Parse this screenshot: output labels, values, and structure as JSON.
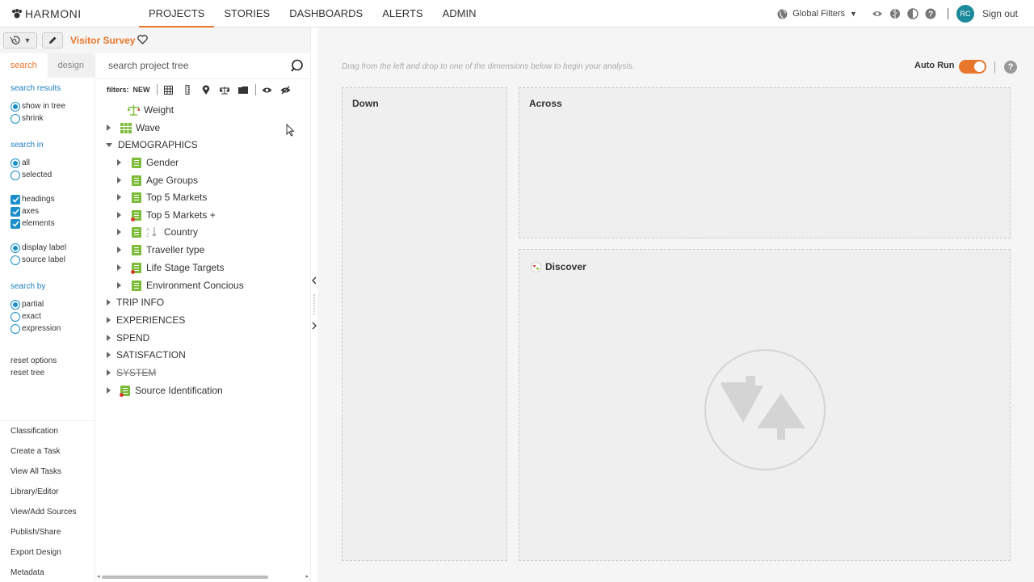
{
  "brand": {
    "name": "HARMONI"
  },
  "nav": {
    "items": [
      {
        "label": "PROJECTS",
        "active": true
      },
      {
        "label": "STORIES"
      },
      {
        "label": "DASHBOARDS"
      },
      {
        "label": "ALERTS"
      },
      {
        "label": "ADMIN"
      }
    ]
  },
  "topright": {
    "global_filters": "Global Filters",
    "icons": [
      "eye-icon",
      "brain-icon",
      "contrast-icon",
      "help-icon"
    ],
    "user_initials": "RC",
    "sign_out": "Sign out"
  },
  "project": {
    "title": "Visitor Survey"
  },
  "left_panel": {
    "tabs": {
      "search": "search",
      "design": "design"
    },
    "search_results": {
      "heading": "search results",
      "options": [
        {
          "label": "show in tree",
          "selected": true
        },
        {
          "label": "shrink",
          "selected": false
        }
      ]
    },
    "search_in": {
      "heading": "search in",
      "scope": [
        {
          "label": "all",
          "selected": true
        },
        {
          "label": "selected",
          "selected": false
        }
      ],
      "types": [
        {
          "label": "headings",
          "checked": true
        },
        {
          "label": "axes",
          "checked": true
        },
        {
          "label": "elements",
          "checked": true
        }
      ],
      "labels": [
        {
          "label": "display label",
          "selected": true
        },
        {
          "label": "source label",
          "selected": false
        }
      ]
    },
    "search_by": {
      "heading": "search by",
      "options": [
        {
          "label": "partial",
          "selected": true
        },
        {
          "label": "exact",
          "selected": false
        },
        {
          "label": "expression",
          "selected": false
        }
      ]
    },
    "links": {
      "reset_options": "reset options",
      "reset_tree": "reset tree"
    },
    "menu": [
      "Classification",
      "Create a Task",
      "View All Tasks",
      "Library/Editor",
      "View/Add Sources",
      "Publish/Share",
      "Export Design",
      "Metadata"
    ]
  },
  "tree_panel": {
    "search_placeholder": "search project tree",
    "filters_label": "filters:",
    "filters_new": "NEW",
    "filter_icons": [
      "grid-icon",
      "ruler-icon",
      "map-pin-icon",
      "scale-icon",
      "folder-icon",
      "eye-icon",
      "eye-off-icon"
    ],
    "nodes": [
      {
        "label": "Weight",
        "icon": "scale-icon",
        "level": 1,
        "expander": "none"
      },
      {
        "label": "Wave",
        "icon": "table-icon",
        "level": 1,
        "expander": "collapsed"
      },
      {
        "label": "DEMOGRAPHICS",
        "icon": "",
        "level": 0,
        "expander": "expanded"
      },
      {
        "label": "Gender",
        "icon": "green-list-icon",
        "level": 2,
        "expander": "collapsed"
      },
      {
        "label": "Age Groups",
        "icon": "green-list-icon",
        "level": 2,
        "expander": "collapsed"
      },
      {
        "label": "Top 5 Markets",
        "icon": "green-list-icon",
        "level": 2,
        "expander": "collapsed"
      },
      {
        "label": "Top 5 Markets +",
        "icon": "green-list-red-icon",
        "level": 2,
        "expander": "collapsed"
      },
      {
        "label": "Country",
        "icon": "green-list-sort-icon",
        "level": 2,
        "expander": "collapsed"
      },
      {
        "label": "Traveller type",
        "icon": "green-list-icon",
        "level": 2,
        "expander": "collapsed"
      },
      {
        "label": "Life Stage Targets",
        "icon": "green-list-red-icon",
        "level": 2,
        "expander": "collapsed"
      },
      {
        "label": "Environment Concious",
        "icon": "green-list-icon",
        "level": 2,
        "expander": "collapsed"
      },
      {
        "label": "TRIP INFO",
        "icon": "",
        "level": 0,
        "expander": "collapsed"
      },
      {
        "label": "EXPERIENCES",
        "icon": "",
        "level": 0,
        "expander": "collapsed"
      },
      {
        "label": "SPEND",
        "icon": "",
        "level": 0,
        "expander": "collapsed"
      },
      {
        "label": "SATISFACTION",
        "icon": "",
        "level": 0,
        "expander": "collapsed"
      },
      {
        "label": "SYSTEM",
        "icon": "",
        "level": 0,
        "expander": "collapsed",
        "strikethrough": true
      },
      {
        "label": "Source Identification",
        "icon": "green-list-red-icon",
        "level": 1,
        "expander": "collapsed"
      }
    ]
  },
  "main": {
    "hint": "Drag from the left and drop to one of the dimensions below to begin your analysis.",
    "auto_run": {
      "label": "Auto Run",
      "on": true
    },
    "zones": {
      "down": "Down",
      "across": "Across",
      "discover": "Discover"
    }
  },
  "colors": {
    "accent": "#e8762b",
    "link": "#1b7fc1",
    "radio": "#1b8ec9",
    "green_icon": "#7dbb3a",
    "avatar": "#1b8a9a"
  }
}
